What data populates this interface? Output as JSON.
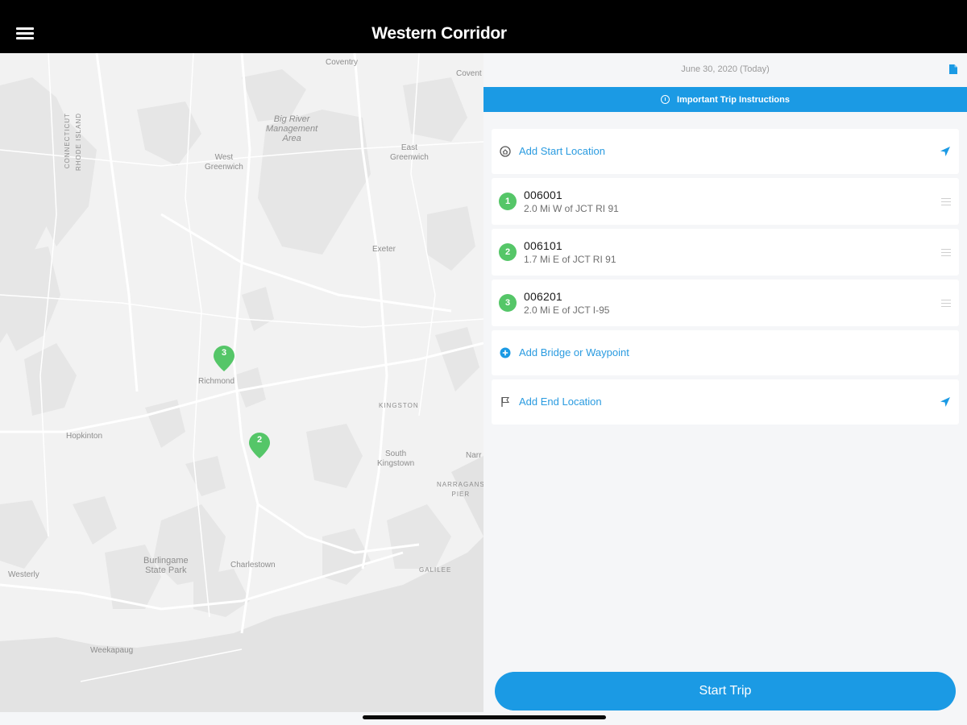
{
  "header": {
    "title": "Western Corridor",
    "menu_icon": "hamburger-menu-icon"
  },
  "map": {
    "labels": {
      "coventry": "Coventry",
      "covert": "Covent",
      "big_river": "Big River\nManagement\nArea",
      "west_greenwich": "West\nGreenwich",
      "east_greenwich": "East\nGreenwich",
      "exeter": "Exeter",
      "connecticut": "CONNECTICUT",
      "rhode_island": "RHODE ISLAND",
      "richmond": "Richmond",
      "kingston": "KINGSTON",
      "hopkinton": "Hopkinton",
      "south_kingstown": "South\nKingstown",
      "narr": "Narr",
      "narragansett_pier": "NARRAGANS\nPIER",
      "burlingame": "Burlingame\nState Park",
      "charlestown": "Charlestown",
      "galilee": "GALILEE",
      "westerly": "Westerly",
      "weekapaug": "Weekapaug"
    },
    "pins": [
      {
        "number": "3",
        "color": "#55c668"
      },
      {
        "number": "2",
        "color": "#55c668"
      }
    ]
  },
  "panel": {
    "date": "June 30, 2020 (Today)",
    "doc_icon": "document-icon",
    "banner": {
      "label": "Important Trip Instructions",
      "icon": "info-icon"
    },
    "start_location": {
      "label": "Add Start Location",
      "icon": "home-icon",
      "action_icon": "location-arrow-icon"
    },
    "stops": [
      {
        "number": "1",
        "id": "006001",
        "description": "2.0 Mi W of JCT RI 91"
      },
      {
        "number": "2",
        "id": "006101",
        "description": "1.7 Mi E of JCT RI 91"
      },
      {
        "number": "3",
        "id": "006201",
        "description": "2.0 Mi E of JCT I-95"
      }
    ],
    "add_waypoint": {
      "label": "Add Bridge or Waypoint",
      "icon": "plus-circle-icon"
    },
    "end_location": {
      "label": "Add End Location",
      "icon": "flag-icon",
      "action_icon": "location-arrow-icon"
    },
    "start_button": "Start Trip"
  },
  "colors": {
    "accent": "#1b9ae4",
    "stop_green": "#55c668",
    "header_bg": "#000000"
  }
}
